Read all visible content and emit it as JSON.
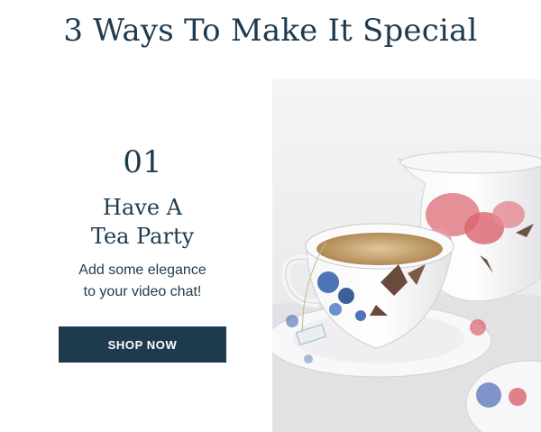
{
  "header": {
    "title": "3 Ways To Make It Special"
  },
  "feature": {
    "number": "01",
    "title_line1": "Have A",
    "title_line2": "Tea Party",
    "desc_line1": "Add some elegance",
    "desc_line2": "to your video chat!",
    "cta_label": "SHOP NOW"
  },
  "image": {
    "subject": "floral-teacup-and-creamer-photo"
  },
  "colors": {
    "navy": "#1e3a4d",
    "text": "#1d3a4f",
    "white": "#ffffff"
  }
}
